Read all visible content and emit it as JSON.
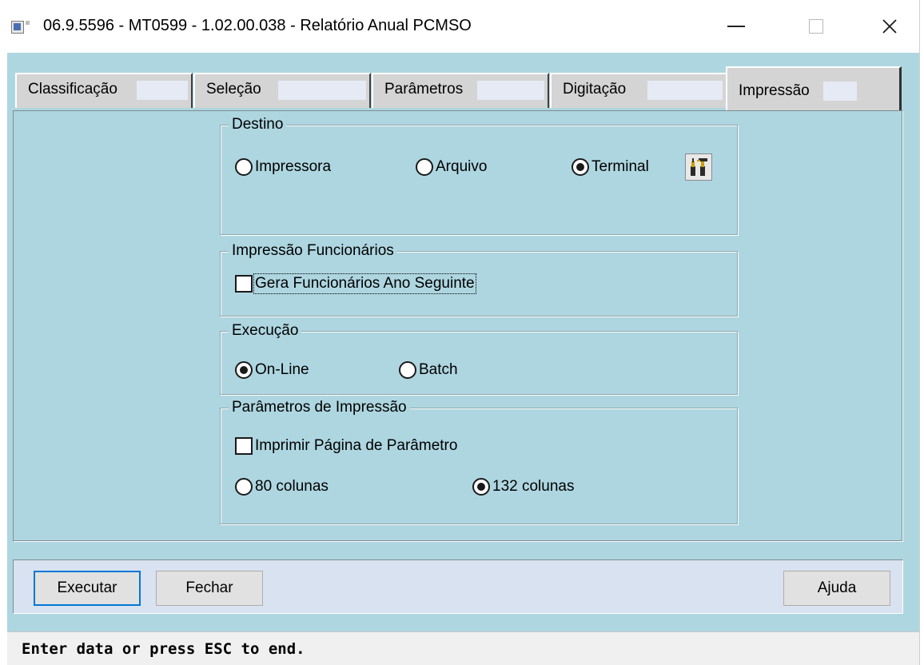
{
  "window": {
    "title": "06.9.5596 - MT0599 - 1.02.00.038 - Relatório Anual PCMSO",
    "icon": "app-window-icon",
    "controls": {
      "minimize": "minimize-icon",
      "maximize": "maximize-icon",
      "close": "close-icon"
    }
  },
  "tabs": [
    {
      "label": "Classificação",
      "active": false
    },
    {
      "label": "Seleção",
      "active": false
    },
    {
      "label": "Parâmetros",
      "active": false
    },
    {
      "label": "Digitação",
      "active": false
    },
    {
      "label": "Impressão",
      "active": true
    }
  ],
  "destino": {
    "title": "Destino",
    "options": [
      {
        "label": "Impressora",
        "selected": false
      },
      {
        "label": "Arquivo",
        "selected": false
      },
      {
        "label": "Terminal",
        "selected": true
      }
    ],
    "config_icon": "printer-setup-tools-icon"
  },
  "impressao_funcionarios": {
    "title": "Impressão Funcionários",
    "checkbox_label": "Gera Funcionários Ano Seguinte",
    "checked": false
  },
  "execucao": {
    "title": "Execução",
    "options": [
      {
        "label": "On-Line",
        "selected": true
      },
      {
        "label": "Batch",
        "selected": false
      }
    ]
  },
  "parametros_impressao": {
    "title": "Parâmetros de Impressão",
    "checkbox_label": "Imprimir Página de Parâmetro",
    "checked": false,
    "options": [
      {
        "label": "80 colunas",
        "selected": false
      },
      {
        "label": "132 colunas",
        "selected": true
      }
    ]
  },
  "buttons": {
    "execute": "Executar",
    "close": "Fechar",
    "help": "Ajuda"
  },
  "status": "Enter data or press ESC to end.",
  "colors": {
    "client_background": "#aed6e0",
    "button_bar": "#d9e2f0",
    "tab_background": "#d4d4d4",
    "default_button_border": "#0078d7"
  }
}
